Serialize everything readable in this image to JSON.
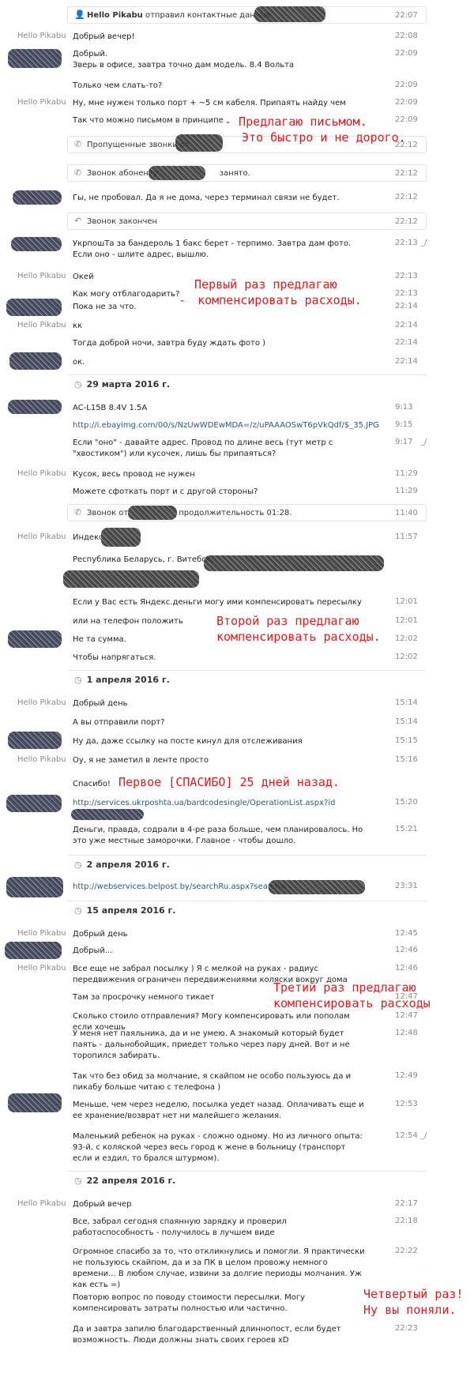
{
  "name": "Hello Pikabu",
  "msg": {
    "m01": {
      "text": "отправил контактные данные",
      "time": "22:07"
    },
    "m02": {
      "text": "Добрый вечер!",
      "time": "22:08"
    },
    "m03": {
      "text": "Добрый.\nЗверь в офисе, завтра точно дам модель. 8.4 Вольта",
      "time": "22:09"
    },
    "m04": {
      "text": "Только чем слать-то?",
      "time": "22:09"
    },
    "m05": {
      "text": "Ну, мне нужен только порт + ~5 см кабеля. Припаять найду чем",
      "time": "22:09"
    },
    "m06": {
      "text": "Так что можно письмом в принципе",
      "time": "22:09"
    },
    "m07": {
      "text": "Пропущенные звонки от",
      "time": "22:12"
    },
    "m08": {
      "text": "Звонок абоненту",
      "text2": "занято.",
      "time": "22:12"
    },
    "m09": {
      "text": "Гы, не пробовал.  Да я не дома, через терминал связи не будет.",
      "time": "22:12"
    },
    "m10": {
      "text": "Звонок закончен",
      "time": "22:12"
    },
    "m11": {
      "text": "УкрпошТа за бандероль 1 бакс берет - терпимо. Завтра дам фото. Если оно - шлите адрес, вышлю.",
      "time": "22:13"
    },
    "m12": {
      "text": "Окей",
      "time": "22:13"
    },
    "m13": {
      "text": "Как могу отблагодарить?",
      "time": "22:13"
    },
    "m14": {
      "text": "Пока не за что.",
      "time": "22:14"
    },
    "m15": {
      "text": "кк",
      "time": "22:14"
    },
    "m16": {
      "text": "Тогда доброй ночи, завтра буду ждать фото )",
      "time": "22:14"
    },
    "m17": {
      "text": "ок.",
      "time": "22:14"
    },
    "d1": "29 марта 2016 г.",
    "m18": {
      "text": "AC-L15B  8.4V 1.5A",
      "time": "9:13"
    },
    "m19": {
      "text": "http://i.ebayimg.com/00/s/NzUwWDEwMDA=/z/uPAAAOSwT6pVkQdf/$_35.JPG",
      "time": "9:15"
    },
    "m20": {
      "text": "Если \"оно\" - давайте адрес. Провод по длине весь (тут метр с \"хвостиком\") или кусочек, лишь бы припаяться?",
      "time": "9:17"
    },
    "m21": {
      "text": "Кусок, весь провод не нужен",
      "time": "11:29"
    },
    "m22": {
      "text": "Можете сфоткать порт и с другой стороны?",
      "time": "11:29"
    },
    "m23": {
      "text": "Звонок от",
      "text2": "продолжительность 01:28.",
      "time": "11:40"
    },
    "m24": {
      "text": "Индекс",
      "time": "11:57"
    },
    "m25": {
      "text": "Республика Беларусь, г. Витебск,"
    },
    "m26": {
      "text": "Если у Вас есть Яндекс.деньги могу ими компенсировать пересылку",
      "time": "12:01"
    },
    "m27": {
      "text": "или на телефон положить",
      "time": "12:01"
    },
    "m28": {
      "text": "Не та сумма.",
      "time": "12:02"
    },
    "m29": {
      "text": "Чтобы напрягаться.",
      "time": "12:02"
    },
    "d2": "1 апреля 2016 г.",
    "m30": {
      "text": "Добрый день",
      "time": "15:14"
    },
    "m31": {
      "text": "А вы отправили порт?",
      "time": "15:14"
    },
    "m32": {
      "text": "Ну да, даже ссылку на посте кинул для отслеживания",
      "time": "15:15"
    },
    "m33": {
      "text": "Оу, я не заметил в ленте просто",
      "time": "15:16"
    },
    "m34": {
      "text": "Спасибо!"
    },
    "m35": {
      "text": "http://services.ukrposhta.ua/bardcodesingle/OperationList.aspx?id",
      "time": "15:20"
    },
    "m36": {
      "text": "Деньги, правда, содрали в 4-ре раза больше, чем планировалось. Но это уже местные заморочки. Главное - чтобы дошло.",
      "time": "15:21"
    },
    "d3": "2 апреля 2016 г.",
    "m37": {
      "text": "http://webservices.belpost.by/searchRu.aspx?search=",
      "time": "23:31"
    },
    "d4": "15 апреля 2016 г.",
    "m38": {
      "text": "Добрый день",
      "time": "12:45"
    },
    "m39": {
      "text": "Добрый...",
      "time": "12:46"
    },
    "m40": {
      "text": "Все еще не забрал посылку ) Я с мелкой на руках - радиус передвижения ограничен передвижениями коляски вокруг дома",
      "time": "12:46"
    },
    "m41": {
      "text": "Там за просрочку немного тикает",
      "time": "12:47"
    },
    "m42": {
      "text": "Сколько стоило отправления? Могу компенсировать или пополам если хочешь",
      "time": "12:47"
    },
    "m43": {
      "text": "У меня нет паяльника, да и не умею. А знакомый который будет паять - дальнобойщик, приедет только через пару дней. Вот и не торопился забирать.",
      "time": "12:48"
    },
    "m44": {
      "text": "Так что без обид за молчание, я скайпом не особо пользуюсь да и пикабу больше читаю с телефона )",
      "time": "12:49"
    },
    "m45": {
      "text": "Меньше, чем через неделю, посылка уедет назад. Оплачивать еще и ее хранение/возврат нет ни малейшего желания.",
      "time": "12:53"
    },
    "m46": {
      "text": "Маленький ребенок на руках - сложно одному. Но из личного опыта: 93-й, с коляской через весь город к жене в больницу (транспорт если и ездил, то брался штурмом).",
      "time": "12:54"
    },
    "d5": "22 апреля 2016 г.",
    "m47": {
      "text": "Добрый вечер",
      "time": "22:17"
    },
    "m48": {
      "text": "Все, забрал сегодня спаянную зарядку и проверил работоспособность - получилось в лучшем виде",
      "time": "22:18"
    },
    "m49": {
      "text": "Огромное спасибо за то, что откликнулись и помогли. Я практически не пользуюсь скайпом, да и за ПК в целом провожу немного времени... В любом случае, извини за долгие периоды молчания. Уж как есть =)",
      "time": "22:22"
    },
    "m50": {
      "text": "Повторю вопрос по поводу стоимости пересылки. Могу компенсировать затраты полностью или частично."
    },
    "m51": {
      "text": "Да и завтра запилю благодарственный длиннопост, если будет возможность. Люди должны знать своих героев xD",
      "time": "22:23"
    }
  },
  "notes": {
    "n1": "- Предлагаю письмом.",
    "n1b": "Это быстро и не дорого.",
    "n2": "Первый раз предлагаю",
    "n2b": "компенсировать расходы.",
    "n2dash": "-",
    "n3": "Второй раз предлагаю",
    "n3b": "компенсировать расходы.",
    "n4": "Первое [СПАСИБО] 25 дней назад.",
    "n5": "Третий раз предлагаю",
    "n5b": "компенсировать расходы",
    "n6": "Четвертый раз!",
    "n6b": "Ну вы поняли."
  },
  "edit_mark": "_/",
  "colors": {
    "annotation": "#e51b1b",
    "link": "#2a5885",
    "meta": "#8a8a8a"
  }
}
